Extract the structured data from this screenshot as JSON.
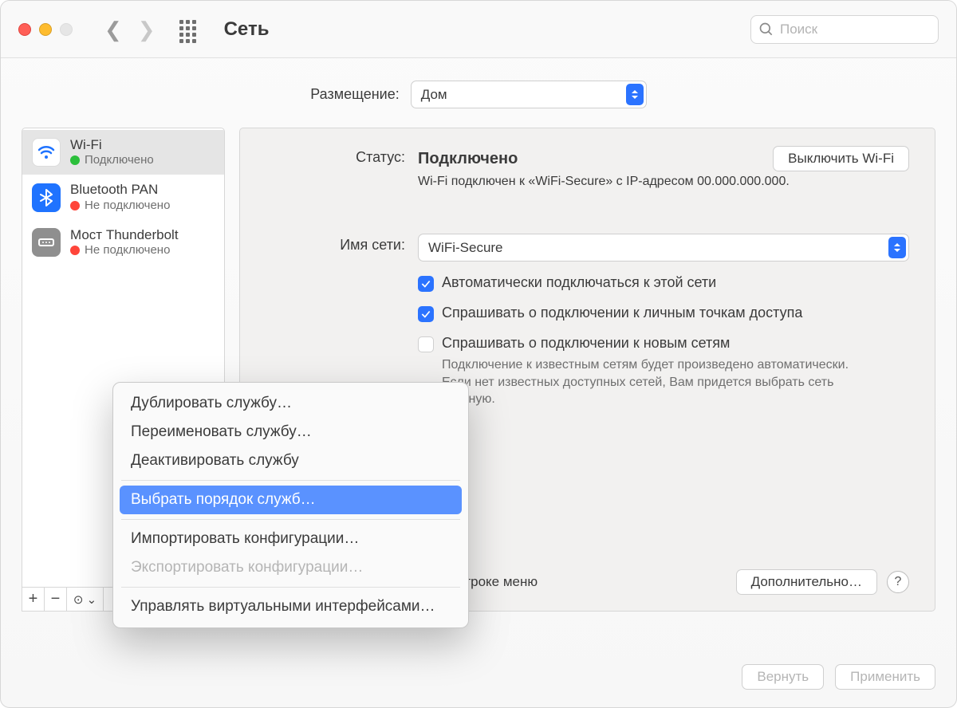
{
  "toolbar": {
    "title": "Сеть",
    "search_placeholder": "Поиск"
  },
  "location": {
    "label": "Размещение:",
    "value": "Дом"
  },
  "services": [
    {
      "name": "Wi-Fi",
      "status": "Подключено",
      "dot": "green",
      "icon": "wifi",
      "selected": true
    },
    {
      "name": "Bluetooth PAN",
      "status": "Не подключено",
      "dot": "red",
      "icon": "bluetooth",
      "selected": false
    },
    {
      "name": "Мост Thunderbolt",
      "status": "Не подключено",
      "dot": "red",
      "icon": "thunderbolt",
      "selected": false
    }
  ],
  "detail": {
    "status_label": "Статус:",
    "status_value": "Подключено",
    "wifi_off_button": "Выключить Wi-Fi",
    "status_sub": "Wi-Fi подключен к «WiFi-Secure» с IP-адресом 00.000.000.000.",
    "network_label": "Имя сети:",
    "network_value": "WiFi-Secure",
    "auto_join": "Автоматически подключаться к этой сети",
    "ask_personal": "Спрашивать о подключении к личным точкам доступа",
    "ask_new": "Спрашивать о подключении к новым сетям",
    "ask_new_hint": "Подключение к известным сетям будет произведено автоматически. Если нет известных доступных сетей, Вам придется выбрать сеть вручную.",
    "show_in_menu": "Показывать статус Wi-Fi в строке меню",
    "advanced_button": "Дополнительно…"
  },
  "context_menu": {
    "duplicate": "Дублировать службу…",
    "rename": "Переименовать службу…",
    "deactivate": "Деактивировать службу",
    "order": "Выбрать порядок служб…",
    "import": "Импортировать конфигурации…",
    "export": "Экспортировать конфигурации…",
    "virtual": "Управлять виртуальными интерфейсами…"
  },
  "footer_buttons": {
    "revert": "Вернуть",
    "apply": "Применить"
  }
}
